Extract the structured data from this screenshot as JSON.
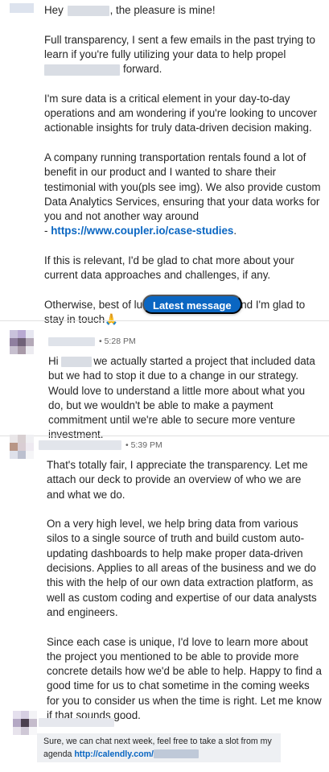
{
  "message1": {
    "greeting_prefix": "Hey",
    "greeting_suffix": ", the pleasure is mine!",
    "p2": "Full transparency, I sent a few emails in the past trying to learn if you're fully utilizing your data to help propel",
    "p2_tail": "forward.",
    "p3": "I'm sure data is a critical element in your day-to-day operations and am wondering if you're looking to uncover actionable insights for truly data-driven decision making.",
    "p4": "A company running transportation rentals found a lot of benefit in our product and I wanted to share their testimonial with you(pls see img). We also provide custom Data Analytics Services, ensuring that your data works for you and not another way around",
    "p4_dash": "- ",
    "p4_link": "https://www.coupler.io/case-studies",
    "p4_link_tail": ".",
    "p5": "If this is relevant, I'd be glad to chat more about your current data approaches and challenges, if any.",
    "p6_start": "Otherwise, best of luc",
    "p6_end": "and I'm glad to stay in touch",
    "p6_emoji": "🙏"
  },
  "latest_message_button": "Latest message",
  "message2": {
    "time": "• 5:28 PM",
    "prefix": "Hi",
    "text": "we actually started a project that included data but we had to stop it due to a change in our strategy. Would love to understand a little more about what you do, but we wouldn't be able to make a payment commitment until we're able to secure more venture investment."
  },
  "message3": {
    "time": "• 5:39 PM",
    "p1": "That's totally fair, I appreciate the transparency. Let me attach our deck to provide an overview of who we are and what we do.",
    "p2": "On a very high level, we help bring data from various silos to a single source of truth and build custom auto-updating dashboards to help make proper data-driven decisions. Applies to all areas of the business and we do this with the help of our own data extraction platform, as well as custom coding and expertise of our data analysts and engineers.",
    "p3": "Since each case is unique, I'd love to learn more about the project you mentioned to be able to provide more concrete details how we'd be able to help. Happy to find a good time for us to chat sometime in the coming weeks for you to consider us when the time is right. Let me know if that sounds good."
  },
  "message4": {
    "text": "Sure, we can chat next week, feel free to take a slot from my agenda",
    "link": "http://calendly.com/"
  }
}
